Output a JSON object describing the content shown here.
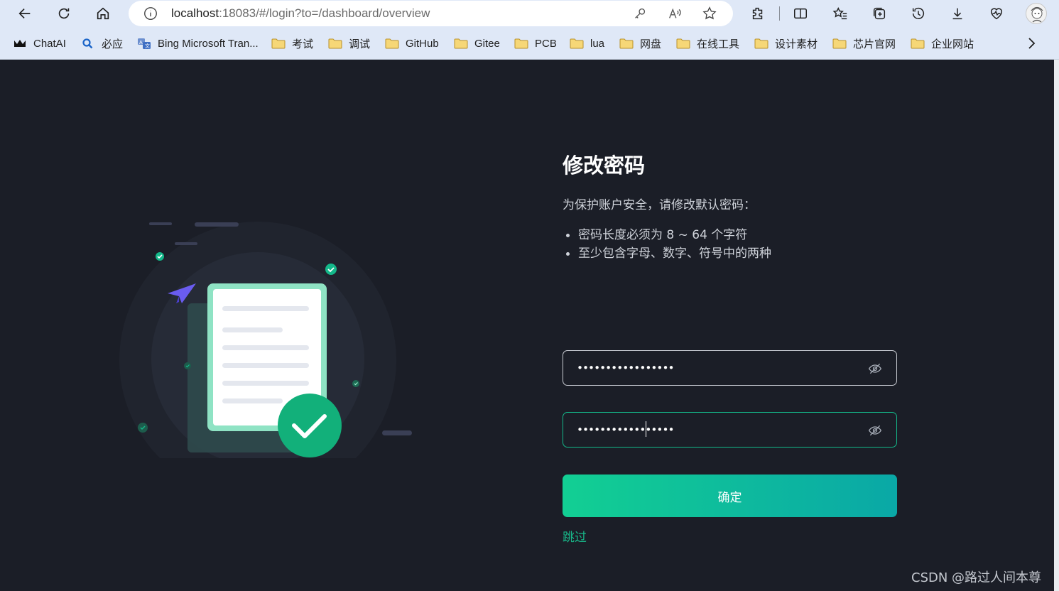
{
  "browser": {
    "url_host": "localhost",
    "url_rest": ":18083/#/login?to=/dashboard/overview",
    "bookmarks": [
      {
        "label": "ChatAI",
        "icon": "chatai-logo-icon"
      },
      {
        "label": "必应",
        "icon": "bing-search-icon"
      },
      {
        "label": "Bing Microsoft Tran...",
        "icon": "translator-icon"
      },
      {
        "label": "考试",
        "icon": "folder-icon"
      },
      {
        "label": "调试",
        "icon": "folder-icon"
      },
      {
        "label": "GitHub",
        "icon": "folder-icon"
      },
      {
        "label": "Gitee",
        "icon": "folder-icon"
      },
      {
        "label": "PCB",
        "icon": "folder-icon"
      },
      {
        "label": "lua",
        "icon": "folder-icon"
      },
      {
        "label": "网盘",
        "icon": "folder-icon"
      },
      {
        "label": "在线工具",
        "icon": "folder-icon"
      },
      {
        "label": "设计素材",
        "icon": "folder-icon"
      },
      {
        "label": "芯片官网",
        "icon": "folder-icon"
      },
      {
        "label": "企业网站",
        "icon": "folder-icon"
      }
    ]
  },
  "form": {
    "title": "修改密码",
    "subtitle": "为保护账户安全，请修改默认密码：",
    "rules": [
      "密码长度必须为 8 ~ 64 个字符",
      "至少包含字母、数字、符号中的两种"
    ],
    "password_value": "•••••••••••••••••",
    "confirm_password_value": "•••••••••••••••••",
    "confirm_label": "确定",
    "skip_label": "跳过"
  },
  "watermark": "CSDN @路过人间本尊",
  "colors": {
    "page_bg": "#1b1e27",
    "accent": "#14b88a",
    "button_gradient_start": "#12cf93",
    "button_gradient_end": "#0aa8a6"
  }
}
